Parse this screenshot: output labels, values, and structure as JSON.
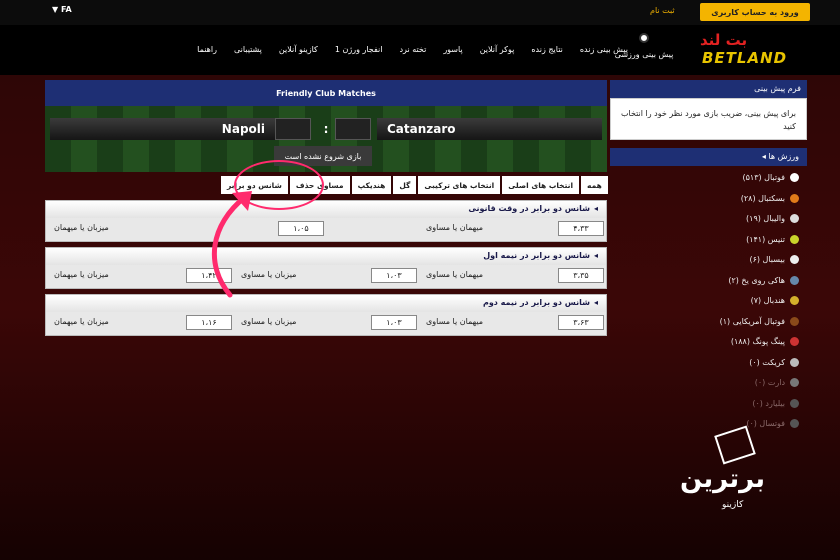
{
  "topbar": {
    "lang": "FA",
    "login_button": "ورود به حساب کاربری",
    "register_link": "ثبت نام"
  },
  "navbar": {
    "logo_top": "بت لند",
    "logo_bottom": "BETLAND",
    "sport_predict": "پیش بینی ورزشی",
    "items": [
      "پیش بینی زنده",
      "نتایج زنده",
      "پوکر آنلاین",
      "پاسور",
      "تخته نرد",
      "انفجار ورژن 1",
      "کازینو آنلاین",
      "پشتیبانی",
      "راهنما"
    ]
  },
  "sidebar": {
    "bet_form_title": "فرم پیش بینی",
    "bet_form_text": "برای پیش بینی، ضریب بازی مورد نظر خود را انتخاب کنید",
    "sports_title": "ورزش ها",
    "sports": [
      {
        "label": "فوتبال (۵۱۳)",
        "color": "#ffffff"
      },
      {
        "label": "بسکتبال (۲۸)",
        "color": "#e07b1a"
      },
      {
        "label": "والیبال (۱۹)",
        "color": "#dddddd"
      },
      {
        "label": "تنیس (۱۴۱)",
        "color": "#c9d42b"
      },
      {
        "label": "بیسبال (۶)",
        "color": "#eeeeee"
      },
      {
        "label": "هاکی روی یخ (۲)",
        "color": "#6688aa"
      },
      {
        "label": "هندبال (۷)",
        "color": "#d4b02b"
      },
      {
        "label": "فوتبال آمریکایی (۱)",
        "color": "#8a4a1a"
      },
      {
        "label": "پینگ پونگ (۱۸۸)",
        "color": "#cc3333"
      },
      {
        "label": "کریکت (۰)",
        "color": "#bbbbbb"
      },
      {
        "label": "دارت (۰)",
        "color": "#777777"
      },
      {
        "label": "بیلیارد (۰)",
        "color": "#555555"
      },
      {
        "label": "فوتسال (۰)",
        "color": "#555555"
      }
    ]
  },
  "match": {
    "title": "Friendly Club Matches",
    "home_team": "Catanzaro",
    "away_team": "Napoli",
    "score_separator": ":",
    "status": "بازی شروع نشده است"
  },
  "tabs": [
    "همه",
    "انتخاب های اصلی",
    "انتخاب های ترکیبی",
    "گل",
    "هندیکپ",
    "مساوی حذف",
    "شانس دو برابر"
  ],
  "markets": [
    {
      "title": "شانس دو برابر در وقت قانونی",
      "options": [
        {
          "label": "میهمان یا مساوی",
          "odd": "۴،۳۳"
        },
        {
          "label": "میزبان یا میهمان",
          "odd": "۱،۰۵"
        }
      ]
    },
    {
      "title": "شانس دو برابر در نیمه اول",
      "options": [
        {
          "label": "میهمان یا مساوی",
          "odd": "۳،۳۵"
        },
        {
          "label": "میزبان یا مساوی",
          "odd": "۱،۰۳"
        },
        {
          "label": "میزبان یا میهمان",
          "odd": "۱،۴۲"
        }
      ]
    },
    {
      "title": "شانس دو برابر در نیمه دوم",
      "options": [
        {
          "label": "میهمان یا مساوی",
          "odd": "۳،۶۳"
        },
        {
          "label": "میزبان یا مساوی",
          "odd": "۱،۰۳"
        },
        {
          "label": "میزبان یا میهمان",
          "odd": "۱،۱۶"
        }
      ]
    }
  ],
  "watermark": {
    "title": "برترین",
    "subtitle": "کازینو"
  },
  "colors": {
    "accent": "#f4b400",
    "panel_head": "#1e2f74",
    "annotation": "#ff2a6d"
  }
}
